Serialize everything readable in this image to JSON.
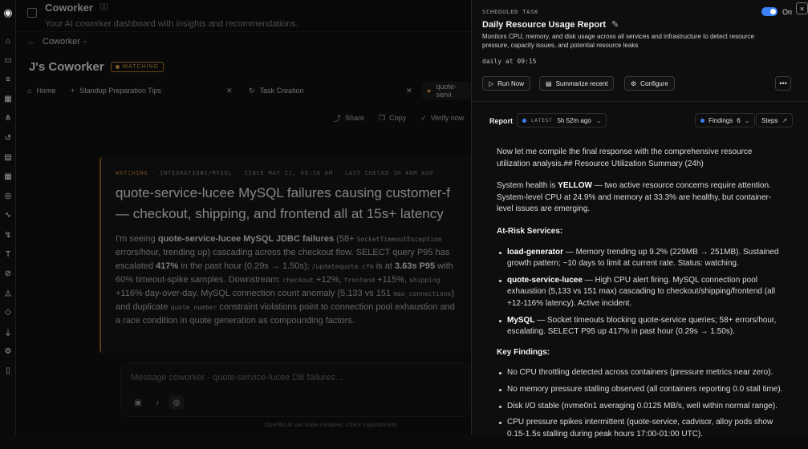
{
  "rail_icons": [
    "logo-icon",
    "home-icon",
    "briefcase-icon",
    "stack-icon",
    "calendar-icon",
    "network-icon",
    "history-icon",
    "database-icon",
    "grid-icon",
    "compass-icon",
    "waveform-icon",
    "chart-icon",
    "hammer-icon",
    "eye-off-icon",
    "shield-icon",
    "flow-icon",
    "plug-icon",
    "gear-icon",
    "book-icon"
  ],
  "header": {
    "title": "Coworker",
    "subtitle": "Your AI coworker dashboard with insights and recommendations."
  },
  "crumb": {
    "back": "←",
    "label": "Coworker"
  },
  "workspace": {
    "name": "J's Coworker",
    "badge": "WATCHING"
  },
  "tabs": [
    {
      "label": "Home"
    },
    {
      "label": "Standup Preparation Tips"
    },
    {
      "label": "Task Creation"
    },
    {
      "label": "quote-servi"
    }
  ],
  "actions": {
    "share": "Share",
    "copy": "Copy",
    "verify": "Verify now"
  },
  "card": {
    "meta_state": "WATCHING",
    "meta_rest": "· INTEGRATIONS/MYSQL · SINCE MAY 21, 05:16 AM · LAST CHECKD 1H 48M AGO",
    "title_line1": "quote-service-lucee MySQL failures causing customer-f",
    "title_line2": "— checkout, shipping, and frontend all at 15s+ latency",
    "body_parts": {
      "p1": "I'm seeing ",
      "b1": "quote-service-lucee MySQL JDBC failures",
      "p2": " (58+ ",
      "c1": "SocketTimeoutException",
      "p3": " errors/hour, trending up) cascading across the checkout flow. SELECT query P95 has escalated ",
      "b2": "417%",
      "p4": " in the past hour (0.29s → 1.50s); ",
      "c2": "/updatequote.cfm",
      "p5": " is at ",
      "b3": "3.63s P95",
      "p6": " with 60% timeout-spike samples. Downstream: ",
      "c3": "checkout",
      "p7": " +12%, ",
      "c4": "frontend",
      "p8": " +115%, ",
      "c5": "shipping",
      "p9": " +116% day-over-day. MySQL connection count anomaly (5,133 vs 151 ",
      "c6": "max_connections",
      "p10": ") and duplicate ",
      "c7": "quote_number",
      "p11": " constraint violations point to connection pool exhaustion and a race condition in quote generation as compounding factors."
    }
  },
  "composer": {
    "placeholder": "Message coworker · quote-service-lucee DB failures..."
  },
  "disclaimer": "OpsPilot AI can make mistakes. Check important info.",
  "panel": {
    "kicker": "SCHEDULED TASK",
    "toggle_label": "On",
    "close": "×",
    "title": "Daily Resource Usage Report",
    "description": "Monitors CPU, memory, and disk usage across all services and infrastructure to detect resource pressure, capacity issues, and potential resource leaks",
    "schedule": "daily at 09:15",
    "buttons": {
      "run": "Run Now",
      "summarize": "Summarize recent",
      "configure": "Configure",
      "more": "•••"
    },
    "report": {
      "label": "Report",
      "latest_tag": "LATEST",
      "latest_time": "5h 52m ago",
      "findings_label": "Findings",
      "findings_count": "6",
      "steps_label": "Steps",
      "intro": "Now let me compile the final response with the comprehensive resource utilization analysis.## Resource Utilization Summary (24h)",
      "health_pre": "System health is ",
      "health_status": "YELLOW",
      "health_post": " — two active resource concerns require attention. System-level CPU at 24.9% and memory at 33.3% are healthy, but container-level issues are emerging.",
      "at_risk_heading": "At-Risk Services:",
      "at_risk": [
        {
          "name": "load-generator",
          "text": " — Memory trending up 9.2% (229MB → 251MB). Sustained growth pattern; ~10 days to limit at current rate. Status: watching."
        },
        {
          "name": "quote-service-lucee",
          "text": " — High CPU alert firing. MySQL connection pool exhaustion (5,133 vs 151 max) cascading to checkout/shipping/frontend (all +12-116% latency). Active incident."
        },
        {
          "name": "MySQL",
          "text": " — Socket timeouts blocking quote-service queries; 58+ errors/hour, escalating. SELECT P95 up 417% in past hour (0.29s → 1.50s)."
        }
      ],
      "key_heading": "Key Findings:",
      "key_findings": [
        "No CPU throttling detected across containers (pressure metrics near zero).",
        "No memory pressure stalling observed (all containers reporting 0.0 stall time).",
        "Disk I/O stable (nvme0n1 averaging 0.0125 MB/s, well within normal range).",
        "CPU pressure spikes intermittent (quote-service, cadvisor, alloy pods show 0.15-1.5s stalling during peak hours 17:00-01:00 UTC)."
      ]
    }
  },
  "colors": {
    "accent": "#3b82f6",
    "watching": "#e0a84a"
  }
}
